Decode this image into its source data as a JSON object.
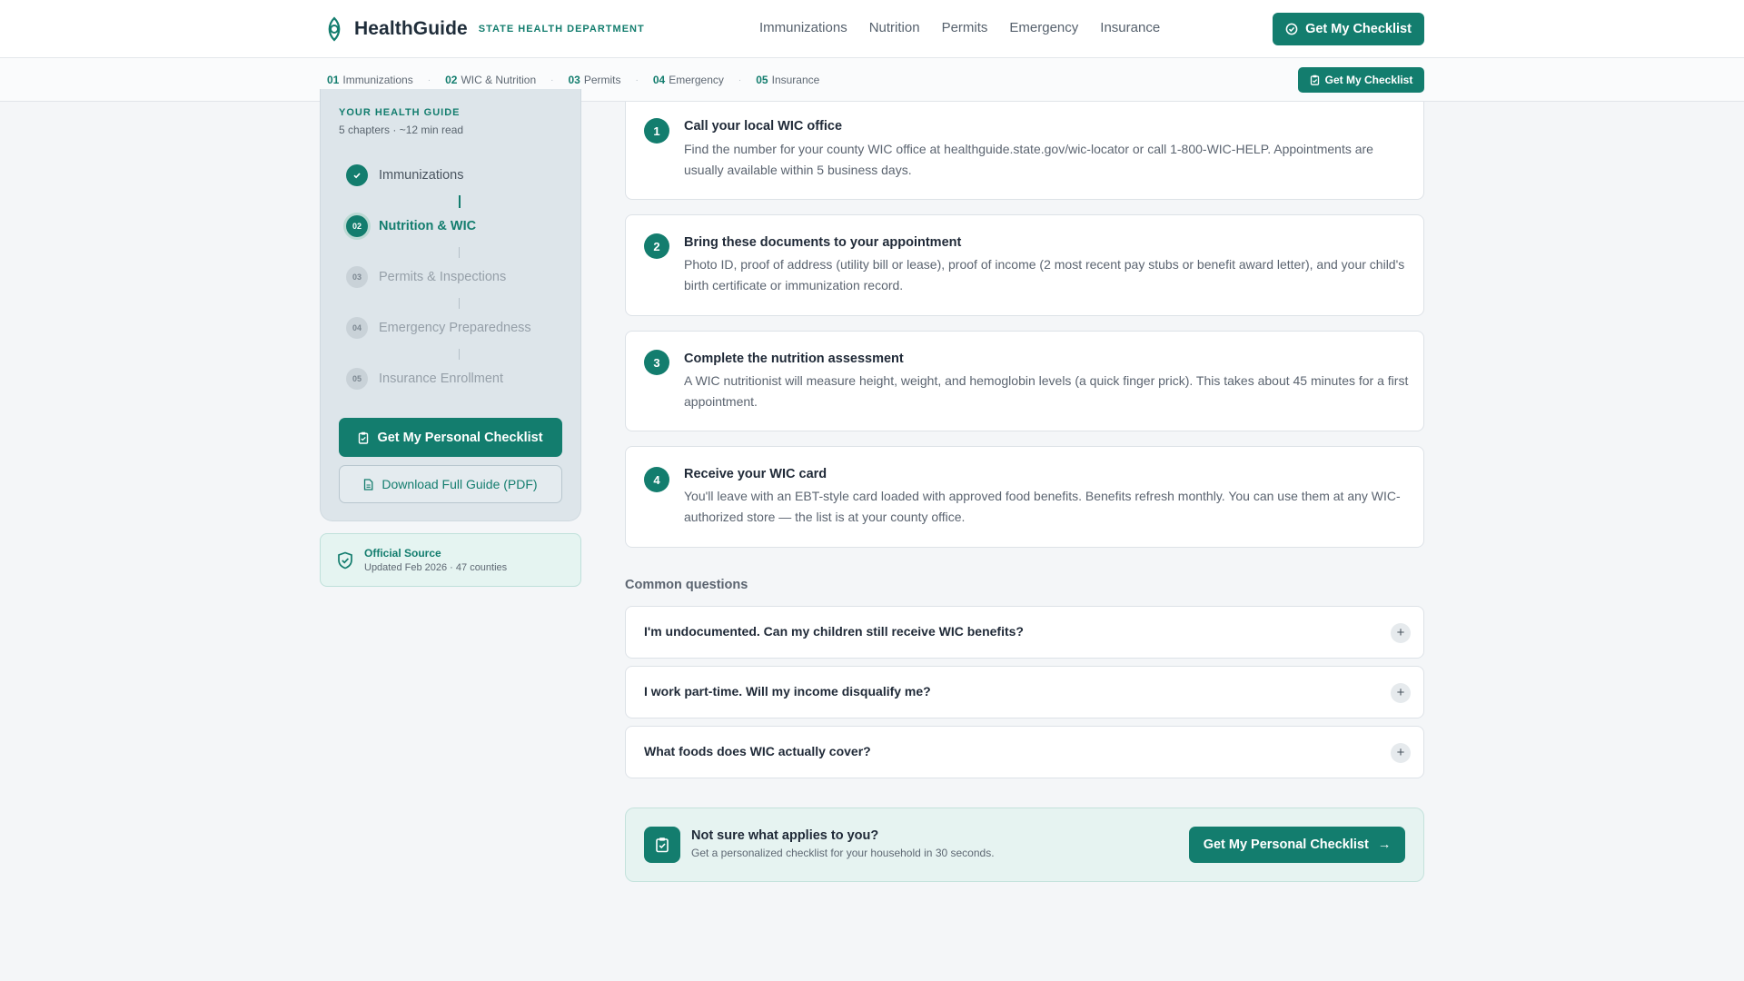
{
  "header": {
    "brand_name": "HealthGuide",
    "brand_sub": "STATE HEALTH DEPARTMENT",
    "nav": [
      "Immunizations",
      "Nutrition",
      "Permits",
      "Emergency",
      "Insurance"
    ],
    "cta_label": "Get My Checklist"
  },
  "chapterbar": {
    "chapters": [
      {
        "num": "01",
        "label": "Immunizations"
      },
      {
        "num": "02",
        "label": "WIC & Nutrition"
      },
      {
        "num": "03",
        "label": "Permits"
      },
      {
        "num": "04",
        "label": "Emergency"
      },
      {
        "num": "05",
        "label": "Insurance"
      }
    ],
    "separator": "·",
    "cta_label": "Get My Checklist"
  },
  "sidebar": {
    "label": "YOUR HEALTH GUIDE",
    "meta": "5 chapters · ~12 min read",
    "steps": [
      {
        "num": "✓",
        "label": "Immunizations",
        "state": "done"
      },
      {
        "num": "02",
        "label": "Nutrition & WIC",
        "state": "active"
      },
      {
        "num": "03",
        "label": "Permits & Inspections",
        "state": "todo"
      },
      {
        "num": "04",
        "label": "Emergency Preparedness",
        "state": "todo"
      },
      {
        "num": "05",
        "label": "Insurance Enrollment",
        "state": "todo"
      }
    ],
    "checklist_button": "Get My Personal Checklist",
    "pdf_button": "Download Full Guide (PDF)",
    "source_title": "Official Source",
    "source_sub": "Updated Feb 2026 · 47 counties"
  },
  "steps": [
    {
      "num": "1",
      "title": "Call your local WIC office",
      "body": "Find the number for your county WIC office at healthguide.state.gov/wic-locator or call 1-800-WIC-HELP. Appointments are usually available within 5 business days."
    },
    {
      "num": "2",
      "title": "Bring these documents to your appointment",
      "body": "Photo ID, proof of address (utility bill or lease), proof of income (2 most recent pay stubs or benefit award letter), and your child's birth certificate or immunization record."
    },
    {
      "num": "3",
      "title": "Complete the nutrition assessment",
      "body": "A WIC nutritionist will measure height, weight, and hemoglobin levels (a quick finger prick). This takes about 45 minutes for a first appointment."
    },
    {
      "num": "4",
      "title": "Receive your WIC card",
      "body": "You'll leave with an EBT-style card loaded with approved food benefits. Benefits refresh monthly. You can use them at any WIC-authorized store — the list is at your county office."
    }
  ],
  "faq": {
    "heading": "Common questions",
    "items": [
      "I'm undocumented. Can my children still receive WIC benefits?",
      "I work part-time. Will my income disqualify me?",
      "What foods does WIC actually cover?"
    ],
    "expand_glyph": "+"
  },
  "cta": {
    "title": "Not sure what applies to you?",
    "sub": "Get a personalized checklist for your household in 30 seconds.",
    "button": "Get My Personal Checklist",
    "arrow": "→"
  },
  "colors": {
    "brand": "#137d6e",
    "text": "#1f2937",
    "muted": "#5b6470",
    "background": "#f4f6f8"
  }
}
